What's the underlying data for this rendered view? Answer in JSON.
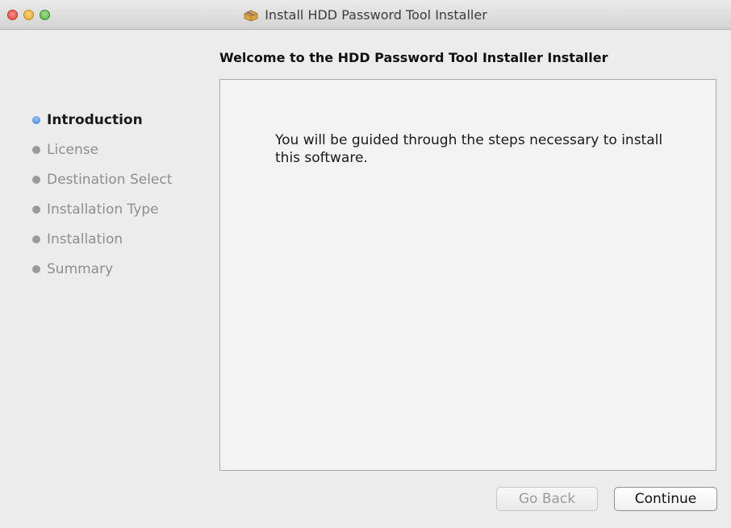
{
  "window": {
    "title": "Install HDD Password Tool Installer",
    "icon": "package-icon"
  },
  "heading": "Welcome to the HDD Password Tool Installer Installer",
  "steps": [
    {
      "label": "Introduction",
      "active": true
    },
    {
      "label": "License",
      "active": false
    },
    {
      "label": "Destination Select",
      "active": false
    },
    {
      "label": "Installation Type",
      "active": false
    },
    {
      "label": "Installation",
      "active": false
    },
    {
      "label": "Summary",
      "active": false
    }
  ],
  "content": {
    "text": "You will be guided through the steps necessary to install this software."
  },
  "buttons": {
    "back": {
      "label": "Go Back",
      "enabled": false
    },
    "continue": {
      "label": "Continue",
      "enabled": true
    }
  },
  "colors": {
    "active_step_dot": "#2f78d8",
    "inactive_step_dot": "#9a9a9a",
    "close": "#e0443e",
    "minimize": "#e1a72c",
    "zoom": "#4fae3a"
  }
}
